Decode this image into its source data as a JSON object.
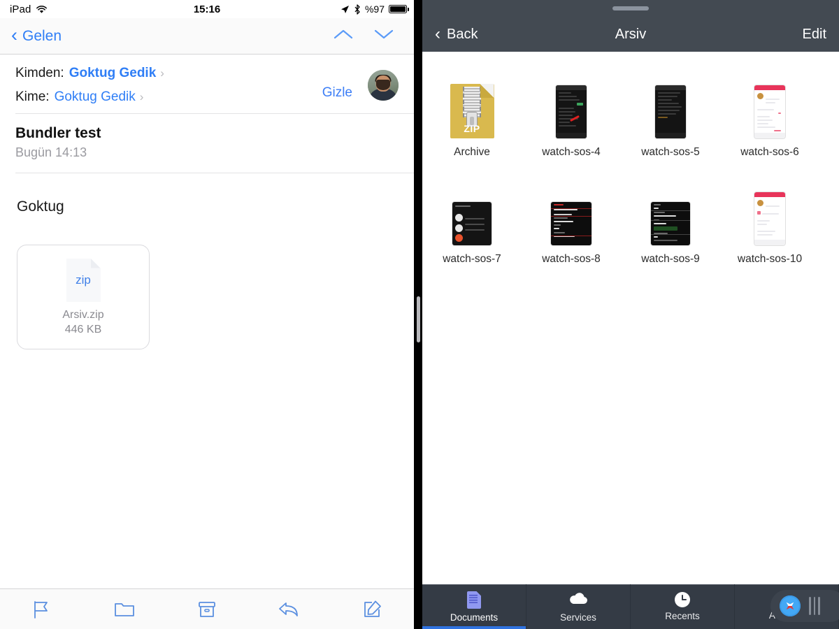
{
  "status_bar": {
    "device": "iPad",
    "wifi_icon": "wifi-icon",
    "time": "15:16",
    "location_icon": "location-arrow-icon",
    "bluetooth_icon": "bluetooth-icon",
    "battery_percent": "%97",
    "battery_icon": "battery-full-icon"
  },
  "mail": {
    "navbar": {
      "back_icon": "chevron-left-icon",
      "back_label": "Gelen",
      "prev_icon": "chevron-up-icon",
      "next_icon": "chevron-down-icon"
    },
    "header": {
      "from_label": "Kimden:",
      "from_name": "Goktug Gedik",
      "to_label": "Kime:",
      "to_name": "Goktug Gedik",
      "disclosure_icon": "chevron-right-icon",
      "hide_label": "Gizle",
      "avatar": "contact-avatar"
    },
    "subject": "Bundler test",
    "date": "Bugün 14:13",
    "body_text": "Goktug",
    "attachment": {
      "type_label": "zip",
      "name": "Arsiv.zip",
      "size": "446 KB"
    },
    "toolbar": [
      {
        "name": "flag-icon",
        "label": "Flag"
      },
      {
        "name": "folder-icon",
        "label": "Move to folder"
      },
      {
        "name": "archive-icon",
        "label": "Archive"
      },
      {
        "name": "reply-icon",
        "label": "Reply"
      },
      {
        "name": "compose-icon",
        "label": "Compose"
      }
    ]
  },
  "documents": {
    "grab_handle": "drag-handle",
    "navbar": {
      "back_icon": "chevron-left-icon",
      "back_label": "Back",
      "title": "Arsiv",
      "edit_label": "Edit"
    },
    "files": [
      {
        "label": "Archive",
        "kind": "zip",
        "zip_text": "ZIP"
      },
      {
        "label": "watch-sos-4",
        "kind": "shot-dark-arrow"
      },
      {
        "label": "watch-sos-5",
        "kind": "shot-dark"
      },
      {
        "label": "watch-sos-6",
        "kind": "shot-light"
      },
      {
        "label": "watch-sos-7",
        "kind": "shot-watch"
      },
      {
        "label": "watch-sos-8",
        "kind": "shot-medical"
      },
      {
        "label": "watch-sos-9",
        "kind": "shot-medical2"
      },
      {
        "label": "watch-sos-10",
        "kind": "shot-light2"
      }
    ],
    "tabs": [
      {
        "label": "Documents",
        "icon": "document-icon",
        "active": true
      },
      {
        "label": "Services",
        "icon": "cloud-icon",
        "active": false
      },
      {
        "label": "Recents",
        "icon": "clock-icon",
        "active": false
      },
      {
        "label": "Add-ons",
        "icon": "cart-icon",
        "active": false
      }
    ],
    "dock": {
      "safari_icon": "safari-compass-icon",
      "grip_icon": "grip-handle-icon"
    }
  },
  "colors": {
    "ios_blue": "#2f7ef6",
    "navbar_dark": "#434a52",
    "tabbar_dark": "#343b45",
    "tab_active_underline": "#2f72e0",
    "zip_gold": "#d9b94e"
  }
}
